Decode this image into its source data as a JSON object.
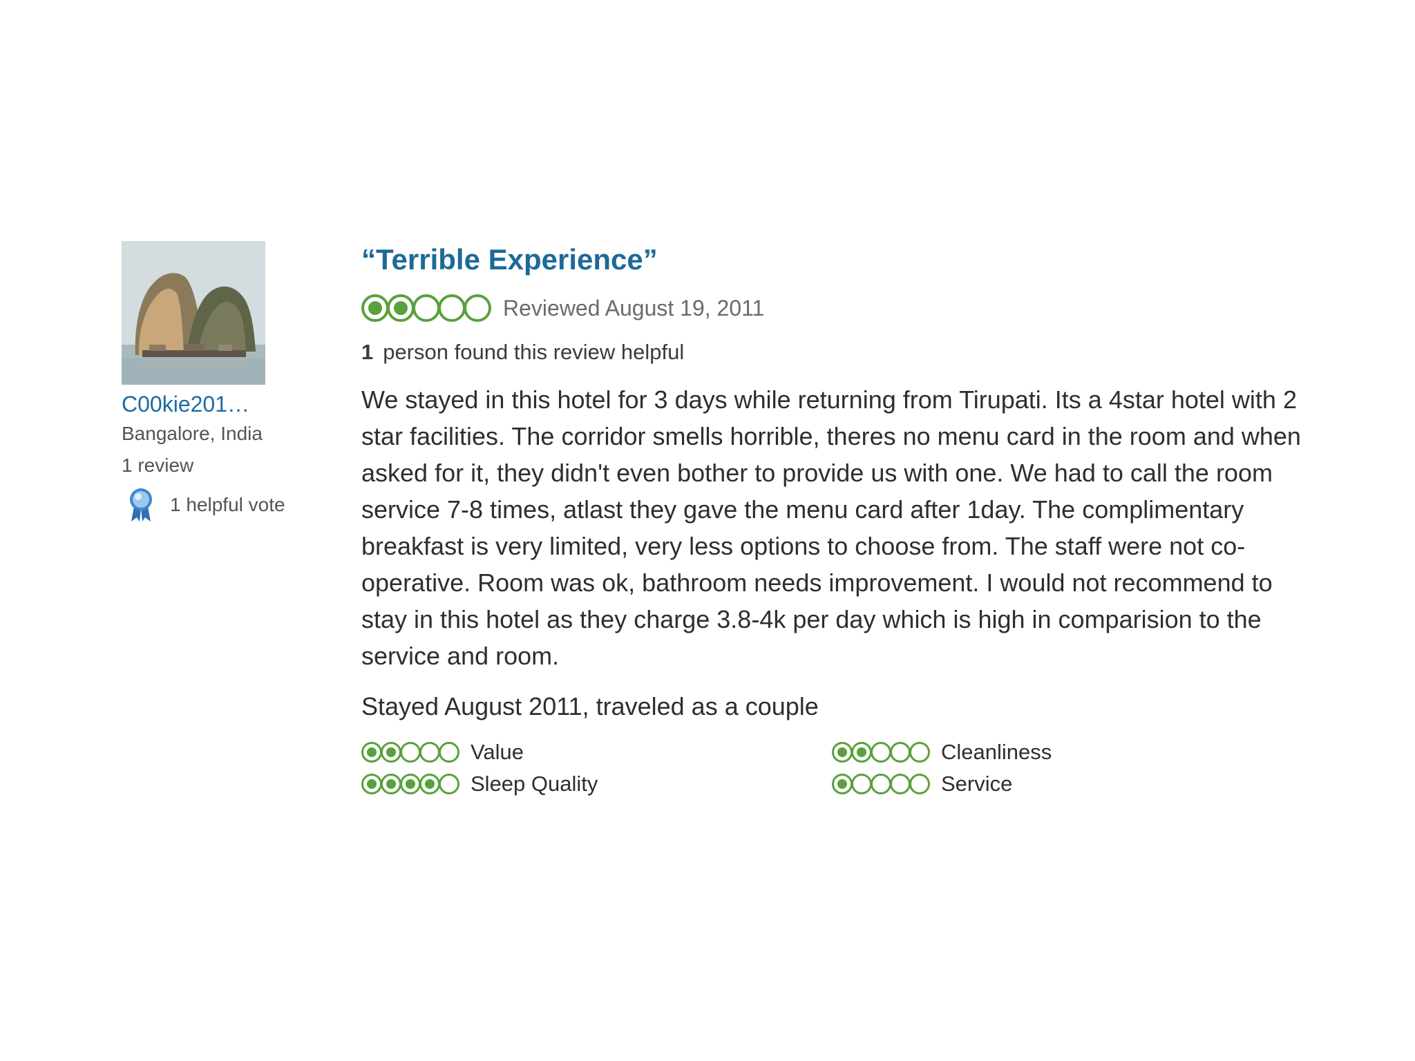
{
  "member": {
    "username": "C00kie201…",
    "location": "Bangalore, India",
    "review_count": "1 review",
    "helpful_votes": "1 helpful vote",
    "avatar_icon": "rock-island-photo",
    "badge_icon": "helpful-vote-ribbon-icon"
  },
  "review": {
    "title": "“Terrible Experience”",
    "rating": 2,
    "rating_max": 5,
    "reviewed_date": "Reviewed August 19, 2011",
    "helpful_count": "1",
    "helpful_text": "person found this review helpful",
    "body": "We stayed in this hotel for 3 days while returning from Tirupati. Its a 4star hotel with 2 star facilities. The corridor smells horrible, theres no menu card in the room and when asked for it, they didn't even bother to provide us with one. We had to call the room service 7-8 times, atlast they gave the menu card after 1day. The complimentary breakfast is very limited, very less options to choose from. The staff were not co-operative. Room was ok, bathroom needs improvement. I would not recommend to stay in this hotel as they charge 3.8-4k per day which is high in comparision to the service and room.",
    "stayed": "Stayed August 2011, traveled as a couple",
    "subratings": [
      {
        "label": "Value",
        "rating": 2
      },
      {
        "label": "Cleanliness",
        "rating": 2
      },
      {
        "label": "Sleep Quality",
        "rating": 4
      },
      {
        "label": "Service",
        "rating": 1
      }
    ]
  },
  "colors": {
    "bubble_green": "#5aa03c",
    "title_blue": "#1c6a98",
    "username_blue": "#1d6aa3"
  }
}
